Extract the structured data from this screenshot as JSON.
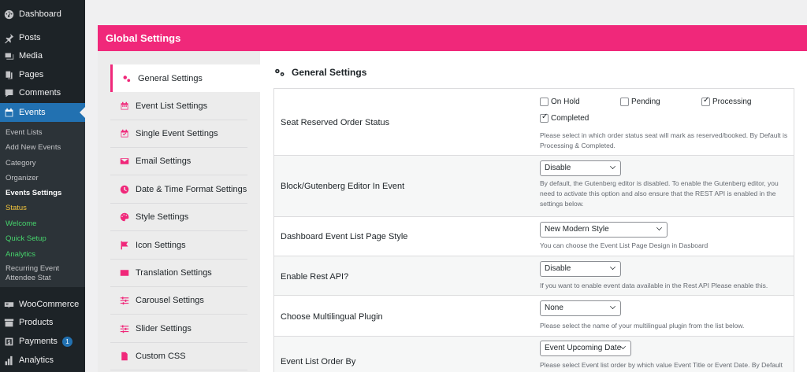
{
  "sidebar": {
    "top_items": [
      {
        "label": "Dashboard",
        "icon": "dashboard-icon"
      },
      {
        "label": "Posts",
        "icon": "pin-icon"
      },
      {
        "label": "Media",
        "icon": "media-icon"
      },
      {
        "label": "Pages",
        "icon": "pages-icon"
      },
      {
        "label": "Comments",
        "icon": "comment-icon"
      },
      {
        "label": "Events",
        "icon": "calendar-icon"
      }
    ],
    "submenu": [
      "Event Lists",
      "Add New Events",
      "Category",
      "Organizer",
      "Events Settings",
      "Status",
      "Welcome",
      "Quick Setup",
      "Analytics",
      "Recurring Event",
      "Attendee Stat"
    ],
    "bottom_items": [
      {
        "label": "WooCommerce",
        "icon": "woocommerce-icon"
      },
      {
        "label": "Products",
        "icon": "archive-icon"
      },
      {
        "label": "Payments",
        "icon": "dollar-icon",
        "badge": "1"
      },
      {
        "label": "Analytics",
        "icon": "chart-icon"
      }
    ],
    "accent": "#2271b1"
  },
  "header": {
    "title": "Global Settings",
    "color": "#f0287a"
  },
  "tabs": [
    {
      "label": "General Settings",
      "icon": "gears-icon"
    },
    {
      "label": "Event List Settings",
      "icon": "calendar-icon"
    },
    {
      "label": "Single Event Settings",
      "icon": "calendar-check-icon"
    },
    {
      "label": "Email Settings",
      "icon": "envelope-icon"
    },
    {
      "label": "Date & Time Format Settings",
      "icon": "clock-icon"
    },
    {
      "label": "Style Settings",
      "icon": "palette-icon"
    },
    {
      "label": "Icon Settings",
      "icon": "flag-icon"
    },
    {
      "label": "Translation Settings",
      "icon": "language-icon"
    },
    {
      "label": "Carousel Settings",
      "icon": "sliders-icon"
    },
    {
      "label": "Slider Settings",
      "icon": "sliders-icon"
    },
    {
      "label": "Custom CSS",
      "icon": "file-icon"
    }
  ],
  "section": {
    "title": "General Settings"
  },
  "settings": {
    "seat_reserved": {
      "label": "Seat Reserved Order Status",
      "options": [
        {
          "label": "On Hold",
          "checked": false
        },
        {
          "label": "Pending",
          "checked": false
        },
        {
          "label": "Processing",
          "checked": true
        },
        {
          "label": "Completed",
          "checked": true
        }
      ],
      "desc": "Please select in which order status seat will mark as reserved/booked. By Default is Processing & Completed."
    },
    "gutenberg": {
      "label": "Block/Gutenberg Editor In Event",
      "value": "Disable",
      "desc": "By default, the Gutenberg editor is disabled. To enable the Gutenberg editor, you need to activate this option and also ensure that the REST API is enabled in the settings below."
    },
    "list_style": {
      "label": "Dashboard Event List Page Style",
      "value": "New Modern Style",
      "desc": "You can choose the Event List Page Design in Dasboard"
    },
    "rest_api": {
      "label": "Enable Rest API?",
      "value": "Disable",
      "desc": "If you want to enable event data available in the Rest API Please enable this."
    },
    "multilingual": {
      "label": "Choose Multilingual Plugin",
      "value": "None",
      "desc": "Please select the name of your multilingual plugin from the list below."
    },
    "order_by": {
      "label": "Event List Order By",
      "value": "Event Upcoming Date",
      "desc": "Please select Event list order by which value Event Title or Event Date. By Default"
    }
  }
}
